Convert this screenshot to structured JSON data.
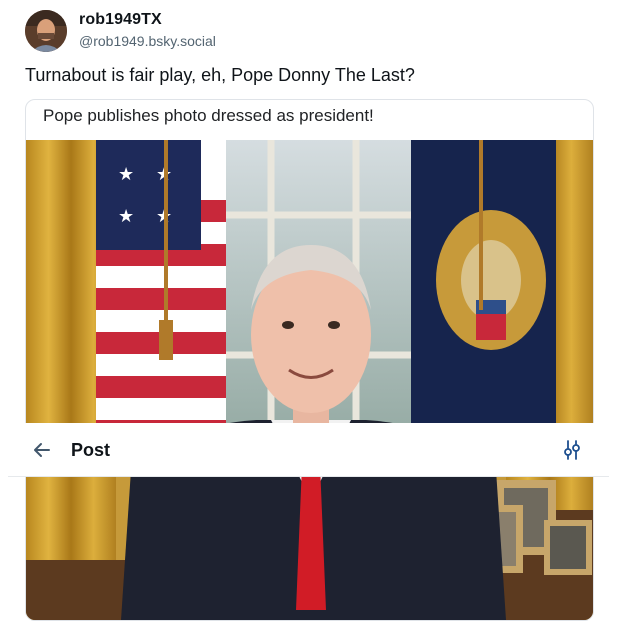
{
  "author": {
    "display_name": "rob1949TX",
    "handle": "@rob1949.bsky.social"
  },
  "post": {
    "text": "Turnabout is fair play, eh, Pope Donny The Last?"
  },
  "embed": {
    "caption": "Pope publishes photo dressed as president!"
  },
  "header": {
    "title": "Post",
    "back_icon": "arrow-left-icon",
    "filter_icon": "sliders-icon"
  },
  "colors": {
    "text": "#0f1419",
    "muted": "#536471",
    "accent": "#1d4f8f"
  }
}
